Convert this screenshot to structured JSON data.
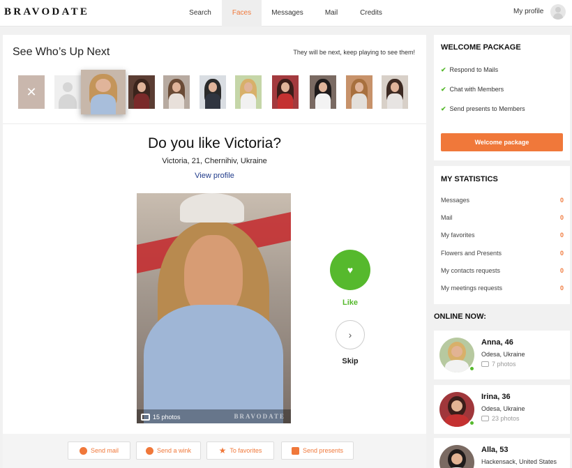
{
  "header": {
    "logo": "BRAVODATE",
    "nav": [
      "Search",
      "Faces",
      "Messages",
      "Mail",
      "Credits"
    ],
    "active_nav": "Faces",
    "my_profile": "My profile"
  },
  "upnext": {
    "title": "See Who’s Up Next",
    "subtitle": "They will be next, keep playing to see them!"
  },
  "candidate": {
    "question": "Do you like Victoria?",
    "details": "Victoria, 21, Chernihiv, Ukraine",
    "view_profile": "View profile",
    "photo_count": "15 photos",
    "watermark": "BRAVODATE",
    "like_label": "Like",
    "skip_label": "Skip"
  },
  "actions": [
    "Send mail",
    "Send a wink",
    "To favorites",
    "Send presents"
  ],
  "welcome_package": {
    "title": "WELCOME PACKAGE",
    "items": [
      "Respond to Mails",
      "Chat with Members",
      "Send presents to Members"
    ],
    "button": "Welcome package"
  },
  "statistics": {
    "title": "MY STATISTICS",
    "rows": [
      {
        "label": "Messages",
        "value": "0"
      },
      {
        "label": "Mail",
        "value": "0"
      },
      {
        "label": "My favorites",
        "value": "0"
      },
      {
        "label": "Flowers and Presents",
        "value": "0"
      },
      {
        "label": "My contacts requests",
        "value": "0"
      },
      {
        "label": "My meetings requests",
        "value": "0"
      }
    ]
  },
  "online": {
    "title": "ONLINE NOW:",
    "people": [
      {
        "name": "Anna, 46",
        "location": "Odesa, Ukraine",
        "photos": "7 photos"
      },
      {
        "name": "Irina, 36",
        "location": "Odesa, Ukraine",
        "photos": "23 photos"
      },
      {
        "name": "Alla, 53",
        "location": "Hackensack, United States",
        "photos": ""
      }
    ]
  },
  "colors": {
    "accent": "#f0783a",
    "like_green": "#56b92d",
    "link_blue": "#1f3a8a"
  }
}
